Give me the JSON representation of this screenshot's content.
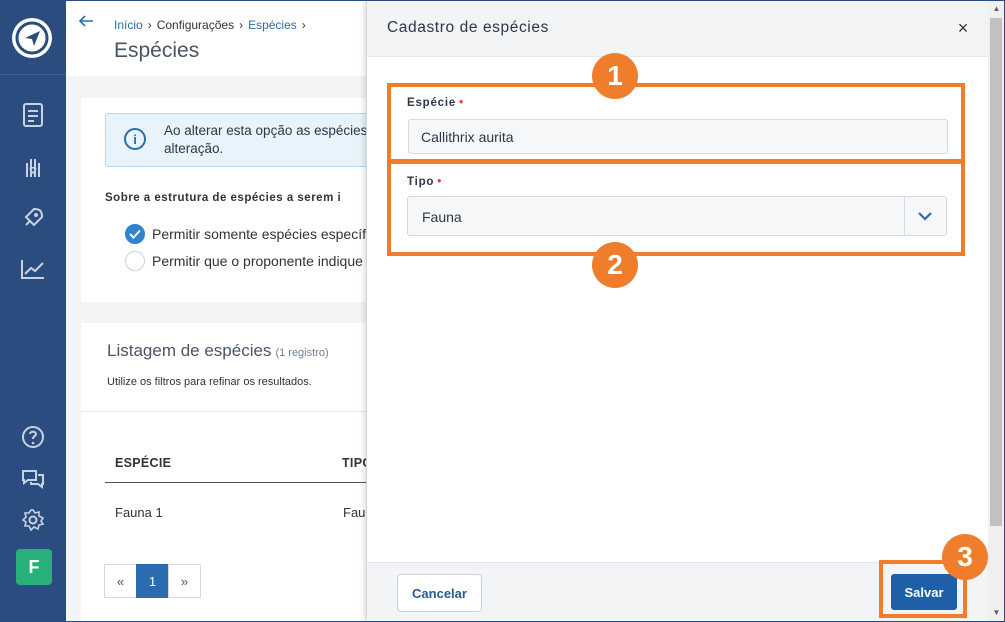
{
  "sidebar": {
    "avatar_initial": "F",
    "icons": [
      "logo-icon",
      "document-icon",
      "hand-heart-icon",
      "rocket-icon",
      "chart-icon",
      "help-icon",
      "chat-icon",
      "gear-icon"
    ]
  },
  "header": {
    "breadcrumb": {
      "home": "Início",
      "settings": "Configurações",
      "current": "Espécies"
    },
    "title": "Espécies"
  },
  "info": {
    "text": "Ao alterar esta opção as espécies alteração."
  },
  "structure": {
    "label": "Sobre a estrutura de espécies a serem i",
    "options": [
      {
        "label": "Permitir somente espécies específic",
        "checked": true
      },
      {
        "label": "Permitir que o proponente indique e",
        "checked": false
      }
    ]
  },
  "listing": {
    "title": "Listagem de espécies",
    "count": "(1 registro)",
    "subtitle": "Utilize os filtros para refinar os resultados.",
    "columns": [
      "ESPÉCIE",
      "TIPO"
    ],
    "rows": [
      {
        "especie": "Fauna 1",
        "tipo": "Faur"
      }
    ],
    "pagination": {
      "prev": "«",
      "page": "1",
      "next": "»"
    }
  },
  "modal": {
    "title": "Cadastro de espécies",
    "close": "×",
    "especie_label": "Espécie",
    "especie_value": "Callithrix aurita",
    "tipo_label": "Tipo",
    "tipo_value": "Fauna",
    "required_mark": "•",
    "cancel_label": "Cancelar",
    "save_label": "Salvar"
  },
  "annotations": {
    "badge1": "1",
    "badge2": "2",
    "badge3": "3",
    "color": "#ef7d2c"
  }
}
